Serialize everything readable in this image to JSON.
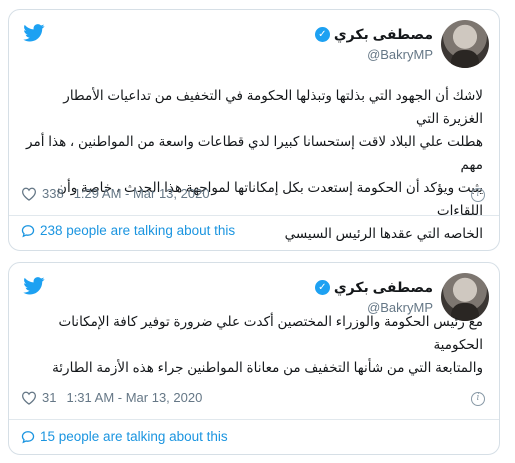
{
  "tweets": [
    {
      "display_name": "مصطفى بكري",
      "handle": "@BakryMP",
      "lines": [
        "لاشك أن الجهود التي بذلتها وتبذلها الحكومة في التخفيف من تداعيات الأمطار الغزيرة التي",
        "هطلت علي البلاد لاقت إستحسانا كبيرا لدي قطاعات واسعة من المواطنين ، هذا أمر مهم",
        "يثبت ويؤكد أن الحكومة إستعدت بكل إمكاناتها لمواجهة هذا الحدث ، خاصة وأن اللقاءات",
        "الخاصه التي عقدها الرئيس السيسي"
      ],
      "likes": "338",
      "timestamp": "1:29 AM - Mar 13, 2020",
      "talking": "238 people are talking about this"
    },
    {
      "display_name": "مصطفى بكري",
      "handle": "@BakryMP",
      "lines": [
        "مع رئيس الحكومة والوزراء المختصين أكدت علي ضرورة توفير كافة الإمكانات الحكومية",
        "والمتابعة التي من شأنها التخفيف من معاناة المواطنين جراء هذه الأزمة الطارئة"
      ],
      "likes": "31",
      "timestamp": "1:31 AM - Mar 13, 2020",
      "talking": "15 people are talking about this"
    }
  ],
  "icons": {
    "bird": "twitter-bird-icon",
    "verified": "verified-badge-icon",
    "heart": "heart-icon",
    "info": "info-icon",
    "bubble": "speech-bubble-icon"
  },
  "colors": {
    "brand_blue": "#1da1f2",
    "link_blue": "#1b95e0",
    "muted_gray": "#657786",
    "text": "#14171a"
  }
}
